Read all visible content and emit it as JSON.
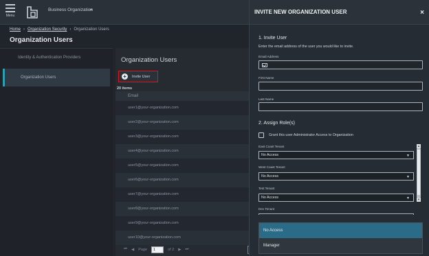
{
  "topbar": {
    "menu_label": "Menu",
    "org_name": "Business Organization"
  },
  "breadcrumb": {
    "home": "Home",
    "security": "Organization Security",
    "current": "Organization Users",
    "sep": "›"
  },
  "page_title": "Organization Users",
  "leftnav": {
    "items": [
      {
        "label": "Identity & Authentication Providers"
      },
      {
        "label": "Organization Users"
      }
    ]
  },
  "main": {
    "title": "Organization Users",
    "invite_label": "Invite User",
    "item_count": "20 items",
    "column_email": "Email",
    "rows": [
      "user1@your-organization.com",
      "user2@your-organization.com",
      "user3@your-organization.com",
      "user4@your-organization.com",
      "user5@your-organization.com",
      "user6@your-organization.com",
      "user7@your-organization.com",
      "user8@your-organization.com",
      "user9@your-organization.com",
      "user10@your-organization.com"
    ],
    "pager": {
      "first": "⏮",
      "prev": "◀",
      "page_label": "Page",
      "page_value": "1",
      "of_label": "of 2",
      "next": "▶",
      "last": "⏭",
      "page_size": "10"
    }
  },
  "panel": {
    "title": "INVITE NEW ORGANIZATION USER",
    "close": "×",
    "section1": "1. Invite User",
    "section1_desc": "Enter the email address of the user you would like to invite.",
    "email_label": "Email Address",
    "first_label": "First Name",
    "last_label": "Last Name",
    "section2": "2. Assign Role(s)",
    "admin_label": "Grant this user Administrator Access to Organization",
    "tenants": [
      {
        "label": "East Coast Tenant",
        "value": "No Access"
      },
      {
        "label": "West Coast Tenant",
        "value": "No Access"
      },
      {
        "label": "Test Tenant",
        "value": "No Access"
      },
      {
        "label": "Dev Tenant",
        "value": ""
      }
    ],
    "dropdown_options": [
      "No Access",
      "Manager"
    ]
  },
  "colors": {
    "accent": "#2e9fb0",
    "highlight": "#e0141a",
    "option_highlight": "#2a6b88"
  }
}
